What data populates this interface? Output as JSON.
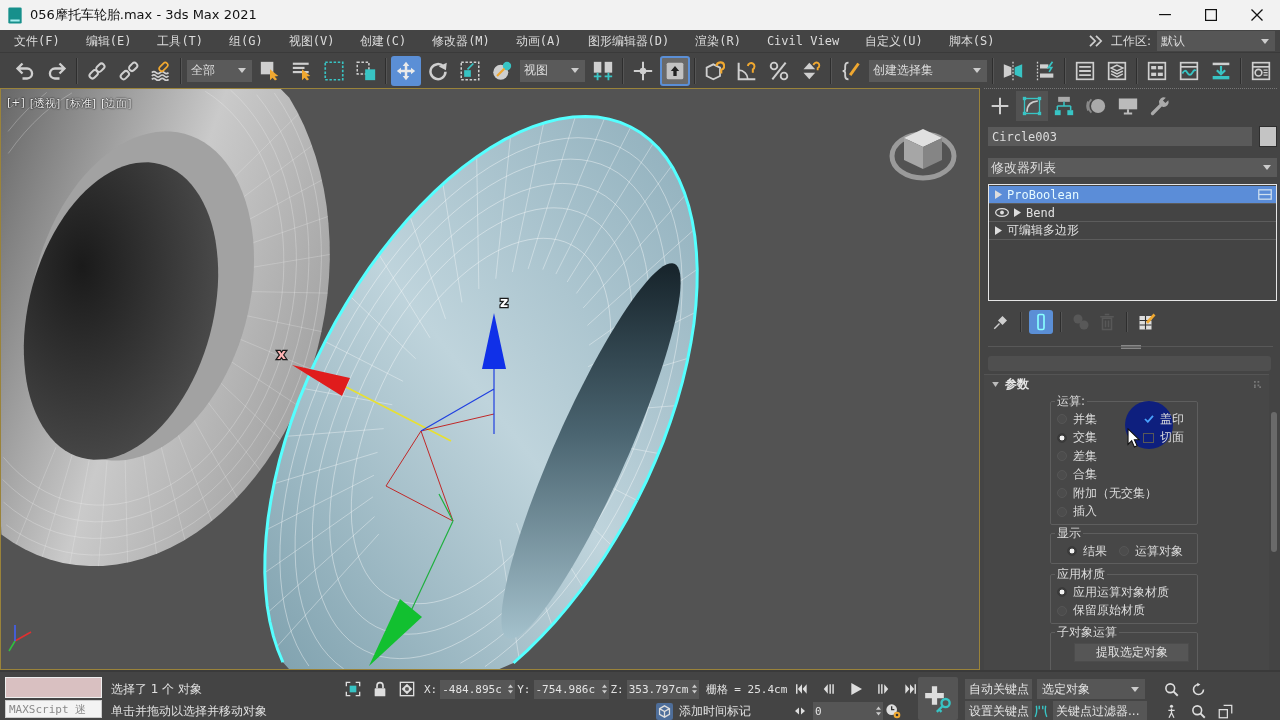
{
  "window": {
    "title": "056摩托车轮胎.max - 3ds Max 2021"
  },
  "menu": {
    "items": [
      "文件(F)",
      "编辑(E)",
      "工具(T)",
      "组(G)",
      "视图(V)",
      "创建(C)",
      "修改器(M)",
      "动画(A)",
      "图形编辑器(D)",
      "渲染(R)",
      "Civil View",
      "自定义(U)",
      "脚本(S)"
    ],
    "workspace_label": "工作区:",
    "workspace": "默认"
  },
  "toolbar": {
    "groups": [
      {
        "items": [
          {
            "kind": "undo",
            "selected": false
          },
          {
            "kind": "redo",
            "selected": false
          }
        ]
      },
      {
        "items": [
          {
            "kind": "link",
            "selected": false
          },
          {
            "kind": "unlink",
            "selected": false
          },
          {
            "kind": "bind",
            "selected": false
          }
        ]
      },
      {
        "items": [
          {
            "kind": "dropdown",
            "value": "全部"
          },
          {
            "kind": "select",
            "selected": false
          },
          {
            "kind": "selname",
            "selected": false
          },
          {
            "kind": "region",
            "selected": false
          },
          {
            "kind": "crossing",
            "selected": false
          }
        ]
      },
      {
        "items": [
          {
            "kind": "move",
            "selected": true
          },
          {
            "kind": "rotate",
            "selected": false
          },
          {
            "kind": "scale",
            "selected": false
          },
          {
            "kind": "place",
            "selected": false
          },
          {
            "kind": "dropdown",
            "value": "视图"
          },
          {
            "kind": "pivot",
            "selected": false
          }
        ]
      },
      {
        "items": [
          {
            "kind": "manipulate",
            "selected": false
          },
          {
            "kind": "override",
            "selected": true
          }
        ]
      },
      {
        "items": [
          {
            "kind": "snap",
            "selected": false
          },
          {
            "kind": "angle",
            "selected": false
          },
          {
            "kind": "percent",
            "selected": false
          },
          {
            "kind": "spinner",
            "selected": false
          }
        ]
      },
      {
        "items": [
          {
            "kind": "namedsel",
            "selected": false
          },
          {
            "kind": "combo",
            "value": "创建选择集"
          }
        ]
      },
      {
        "items": [
          {
            "kind": "mirror",
            "selected": false
          },
          {
            "kind": "align",
            "selected": false
          }
        ]
      },
      {
        "items": [
          {
            "kind": "scene",
            "selected": false
          },
          {
            "kind": "layer",
            "selected": false
          }
        ]
      },
      {
        "items": [
          {
            "kind": "ribbon",
            "selected": false
          },
          {
            "kind": "curve",
            "selected": false
          },
          {
            "kind": "schematic",
            "selected": false
          }
        ]
      },
      {
        "items": [
          {
            "kind": "material",
            "selected": false
          }
        ]
      }
    ]
  },
  "viewport": {
    "labels": [
      "[+]",
      "[透视]",
      "[标准]",
      "[边面]"
    ],
    "gizmo": {
      "x_label": "x",
      "z_label": "z"
    }
  },
  "command_panel": {
    "tabs": [
      {
        "kind": "create",
        "selected": false
      },
      {
        "kind": "modify",
        "selected": true
      },
      {
        "kind": "hierarchy",
        "selected": false
      },
      {
        "kind": "motion",
        "selected": false
      },
      {
        "kind": "display",
        "selected": false
      },
      {
        "kind": "utilities",
        "selected": false
      }
    ],
    "object_name": "Circle003",
    "modifier_list": "修改器列表",
    "stack": [
      {
        "name": "ProBoolean",
        "kind": "object",
        "selected": true
      },
      {
        "name": "Bend",
        "kind": "modifier",
        "selected": false
      },
      {
        "name": "可编辑多边形",
        "kind": "object",
        "selected": false
      }
    ],
    "stack_tools": {
      "groups": [
        {
          "items": [
            {
              "kind": "pin",
              "selected": false,
              "disabled": false
            }
          ]
        },
        {
          "items": [
            {
              "kind": "endresult",
              "selected": true,
              "disabled": false
            }
          ]
        },
        {
          "items": [
            {
              "kind": "unique",
              "selected": false,
              "disabled": true
            },
            {
              "kind": "remove",
              "selected": false,
              "disabled": true
            }
          ]
        },
        {
          "items": [
            {
              "kind": "configure",
              "selected": false,
              "disabled": false
            }
          ]
        }
      ]
    },
    "rollout": {
      "title": "参数",
      "operation": {
        "label": "运算:",
        "options": [
          {
            "label": "并集",
            "selected": false
          },
          {
            "label": "交集",
            "selected": true
          },
          {
            "label": "差集",
            "selected": false
          },
          {
            "label": "合集",
            "selected": false
          },
          {
            "label": "附加（无交集）",
            "selected": false
          },
          {
            "label": "插入",
            "selected": false
          }
        ],
        "checks": [
          {
            "label": "盖印",
            "checked": true
          },
          {
            "label": "切面",
            "checked": false
          }
        ]
      },
      "display": {
        "label": "显示",
        "options": [
          {
            "label": "结果",
            "selected": true
          },
          {
            "label": "运算对象",
            "selected": false
          }
        ]
      },
      "material": {
        "label": "应用材质",
        "options": [
          {
            "label": "应用运算对象材质",
            "selected": true
          },
          {
            "label": "保留原始材质",
            "selected": false
          }
        ]
      },
      "sub_object": {
        "label": "子对象运算",
        "button": "提取选定对象"
      }
    }
  },
  "status_bar": {
    "maxscript": "MAXScript 迷",
    "selection": "选择了 1 个 对象",
    "prompt": "单击并拖动以选择并移动对象",
    "coords": [
      {
        "axis": "X:",
        "value": "-484.895c"
      },
      {
        "axis": "Y:",
        "value": "-754.986c"
      },
      {
        "axis": "Z:",
        "value": "353.797cm"
      }
    ],
    "grid": "栅格 = 25.4cm",
    "time_tag": "添加时间标记",
    "frame": "0",
    "auto_key": "自动关键点",
    "key_target": "选定对象",
    "set_key": "设置关键点",
    "key_filters": "关键点过滤器..."
  }
}
